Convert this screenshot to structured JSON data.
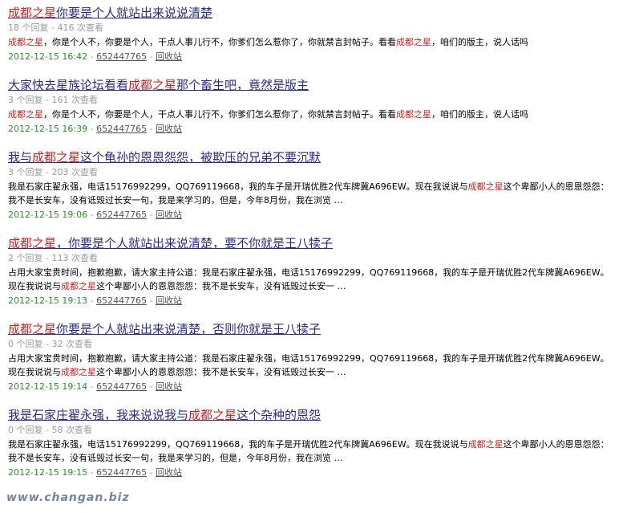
{
  "keyword": "成都之星",
  "meta_tpl": {
    "replies_suffix": " 个回复 - ",
    "views_suffix": " 次查看"
  },
  "foot_sep": " - ",
  "results": [
    {
      "title_parts": [
        {
          "text": "成都之星",
          "kw": true
        },
        {
          "text": "你要是个人就站出来说说清楚",
          "kw": false
        }
      ],
      "replies": "18",
      "views": "416",
      "snippet_parts": [
        {
          "text": "成都之星",
          "kw": true
        },
        {
          "text": "，你是个人不，你要是个人，干点人事儿行不，你爹们怎么惹你了，你就禁言封帖子。看看",
          "kw": false
        },
        {
          "text": "成都之星",
          "kw": true
        },
        {
          "text": "，咱们的版主，说人话吗",
          "kw": false
        }
      ],
      "date": "2012-12-15 16:42",
      "user": "652447765",
      "action": "回收站"
    },
    {
      "title_parts": [
        {
          "text": "大家快去星族论坛看看",
          "kw": false
        },
        {
          "text": "成都之星",
          "kw": true
        },
        {
          "text": "那个畜生吧，竟然是版主",
          "kw": false
        }
      ],
      "replies": "3",
      "views": "161",
      "snippet_parts": [
        {
          "text": "成都之星",
          "kw": true
        },
        {
          "text": "，你是个人不，你要是个人，干点人事儿行不，你爹们怎么惹你了，你就禁言封帖子。看看",
          "kw": false
        },
        {
          "text": "成都之星",
          "kw": true
        },
        {
          "text": "，咱们的版主，说人话吗",
          "kw": false
        }
      ],
      "date": "2012-12-15 16:39",
      "user": "652447765",
      "action": "回收站"
    },
    {
      "title_parts": [
        {
          "text": "我与",
          "kw": false
        },
        {
          "text": "成都之星",
          "kw": true
        },
        {
          "text": "这个龟孙的恩恩怨怨，被欺压的兄弟不要沉默",
          "kw": false
        }
      ],
      "replies": "3",
      "views": "203",
      "snippet_parts": [
        {
          "text": "我是石家庄翟永强，电话15176992299，QQ769119668，我的车子是开瑞优胜2代车牌冀A696EW。现在我说说与",
          "kw": false
        },
        {
          "text": "成都之星",
          "kw": true
        },
        {
          "text": "这个卑鄙小人的恩恩怨怨：我不是长安车，没有诋毁过长安一句，我是来学习的，但是，今年8月份，我在浏览 …",
          "kw": false
        }
      ],
      "date": "2012-12-15 19:06",
      "user": "652447765",
      "action": "回收站"
    },
    {
      "title_parts": [
        {
          "text": "成都之星",
          "kw": true
        },
        {
          "text": "，你要是个人就站出来说清楚，要不你就是王八犊子",
          "kw": false
        }
      ],
      "replies": "2",
      "views": "113",
      "snippet_parts": [
        {
          "text": "占用大家宝贵时间，抱歉抱歉，请大家主持公道：我是石家庄翟永强，电话15176992299，QQ769119668，我的车子是开瑞优胜2代车牌冀A696EW。现在我说说与",
          "kw": false
        },
        {
          "text": "成都之星",
          "kw": true
        },
        {
          "text": "这个卑鄙小人的恩恩怨怨：我不是长安车，没有诋毁过长安一 …",
          "kw": false
        }
      ],
      "date": "2012-12-15 19:13",
      "user": "652447765",
      "action": "回收站"
    },
    {
      "title_parts": [
        {
          "text": "成都之星",
          "kw": true
        },
        {
          "text": "你要是个人就站出来说清楚，否则你就是王八犊子",
          "kw": false
        }
      ],
      "replies": "0",
      "views": "32",
      "snippet_parts": [
        {
          "text": "占用大家宝贵时间，抱歉抱歉，请大家主持公道：我是石家庄翟永强，电话15176992299，QQ769119668，我的车子是开瑞优胜2代车牌冀A696EW。现在我说说与",
          "kw": false
        },
        {
          "text": "成都之星",
          "kw": true
        },
        {
          "text": "这个卑鄙小人的恩恩怨怨：我不是长安车，没有诋毁过长安一 …",
          "kw": false
        }
      ],
      "date": "2012-12-15 19:14",
      "user": "652447765",
      "action": "回收站"
    },
    {
      "title_parts": [
        {
          "text": "我是石家庄翟永强，我来说说我与",
          "kw": false
        },
        {
          "text": "成都之星",
          "kw": true
        },
        {
          "text": "这个杂种的恩怨",
          "kw": false
        }
      ],
      "replies": "0",
      "views": "58",
      "snippet_parts": [
        {
          "text": "我是石家庄翟永强，电话15176992299，QQ769119668，我的车子是开瑞优胜2代车牌冀A696EW。现在我说说与",
          "kw": false
        },
        {
          "text": "成都之星",
          "kw": true
        },
        {
          "text": "这个卑鄙小人的恩恩怨怨：我不是长安车，没有诋毁过长安一句，我是来学习的，但是，今年8月份，我在浏览 …",
          "kw": false
        }
      ],
      "date": "2012-12-15 19:15",
      "user": "652447765",
      "action": "回收站"
    }
  ],
  "watermark": "www.changan.biz"
}
